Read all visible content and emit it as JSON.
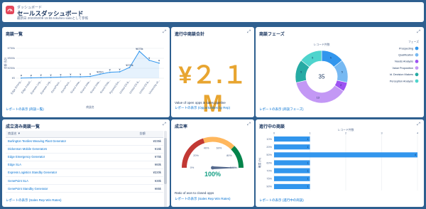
{
  "header": {
    "kicker": "ダッシュボード",
    "title": "セールスダッシュボード",
    "subtitle": "最新日 2023/02/09 15:55 tokuhiro saitoとして参照"
  },
  "panels": {
    "opps": {
      "title": "商談一覧",
      "footer": "レポートの表示 (商談一覧)",
      "chart_data": {
        "type": "line",
        "categories": [
          "Edge Emerg...",
          "Edge Install...",
          "Express Log...",
          "Express Log...",
          "GenePoint ...",
          "GenePoint ...",
          "Grand Hote...",
          "Grand Hote...",
          "Grand Hote...",
          "Grand Hote...",
          "Pyramid Em...",
          "United Oil &...",
          "United Oil &...",
          "United Oil &...",
          "University of..."
        ],
        "values": [
          5,
          10,
          15,
          22,
          30,
          35,
          35,
          45,
          100,
          150,
          160,
          270,
          675,
          450,
          380
        ],
        "labels": [
          "¥",
          "¥",
          "¥",
          "¥",
          "¥",
          "¥",
          "¥",
          "¥",
          "¥25m",
          "¥",
          "¥",
          "¥270k",
          "¥675k",
          "¥",
          "¥"
        ],
        "y_ticks": [
          "¥750k",
          "¥500k",
          "¥250k",
          "¥0"
        ],
        "ylim": [
          0,
          750
        ],
        "ylabel": "金額 合計",
        "xlabel": "商談名"
      }
    },
    "pipeline": {
      "title": "進行中商談合計",
      "value": "¥２.１M",
      "note": "Value of open opps in sales pipeline",
      "footer": "レポートの表示 (Opportunities by Rep)"
    },
    "phase": {
      "title": "商談フェーズ",
      "footer": "レポートの表示 (商談フェーズ)",
      "chart_data": {
        "type": "pie",
        "title": "レコード件数",
        "total": "35",
        "legend_title": "フェーズ",
        "slices": [
          {
            "name": "Prospecting",
            "value": 5,
            "color": "#3296ed"
          },
          {
            "name": "Qualification",
            "value": 5,
            "color": "#77b9f2"
          },
          {
            "name": "Needs Analysis",
            "value": 2,
            "color": "#9d53f2"
          },
          {
            "name": "Value Proposition",
            "value": 13,
            "color": "#c398f5"
          },
          {
            "name": "Id. Decision Makers",
            "value": 5,
            "color": "#26aba4"
          },
          {
            "name": "Perception Analysis",
            "value": 5,
            "color": "#4ed4cd"
          }
        ],
        "labels": [
          "5",
          "4",
          "4",
          "5",
          "13",
          "4",
          "2"
        ]
      }
    },
    "closed": {
      "title": "成立済み商談一覧",
      "footer": "レポートの表示 (Sales Rep Win Rates)",
      "columns": [
        "商談名 ▼",
        "金額"
      ],
      "rows": [
        {
          "name": "Burlington Textiles Weaving Plant Generator",
          "amount": "¥235k"
        },
        {
          "name": "Dickenson Mobile Generators",
          "amount": "¥15k"
        },
        {
          "name": "Edge Emergency Generator",
          "amount": "¥75k"
        },
        {
          "name": "Edge SLA",
          "amount": "¥60k"
        },
        {
          "name": "Express Logistics Standby Generator",
          "amount": "¥220k"
        },
        {
          "name": "GenePoint SLA",
          "amount": "¥30k"
        },
        {
          "name": "GenePoint Standby Generator",
          "amount": "¥85k"
        }
      ]
    },
    "winrate": {
      "title": "成立率",
      "value": "100%",
      "gauge_value": 1.0,
      "ticks": [
        "0%",
        "20%",
        "40%",
        "60%",
        "80%",
        "100%"
      ],
      "note": "Ratio of won to closed opps",
      "footer": "レポートの表示 (Sales Rep Win Rates)"
    },
    "progress": {
      "title": "進行中の商談",
      "footer": "レポートの表示 (進行中の商談)",
      "chart_data": {
        "type": "bar",
        "title": "レコード件数",
        "categories": [
          "10%",
          "20%",
          "50%",
          "60%",
          "70%",
          "75%",
          "90%"
        ],
        "values": [
          1,
          1,
          4,
          1,
          1,
          1,
          1
        ],
        "x_ticks": [
          "0",
          "1",
          "2",
          "3",
          "4"
        ],
        "xlim": [
          0,
          4
        ],
        "ylabel": "確度 (%)",
        "color": "#3296ed"
      }
    }
  }
}
